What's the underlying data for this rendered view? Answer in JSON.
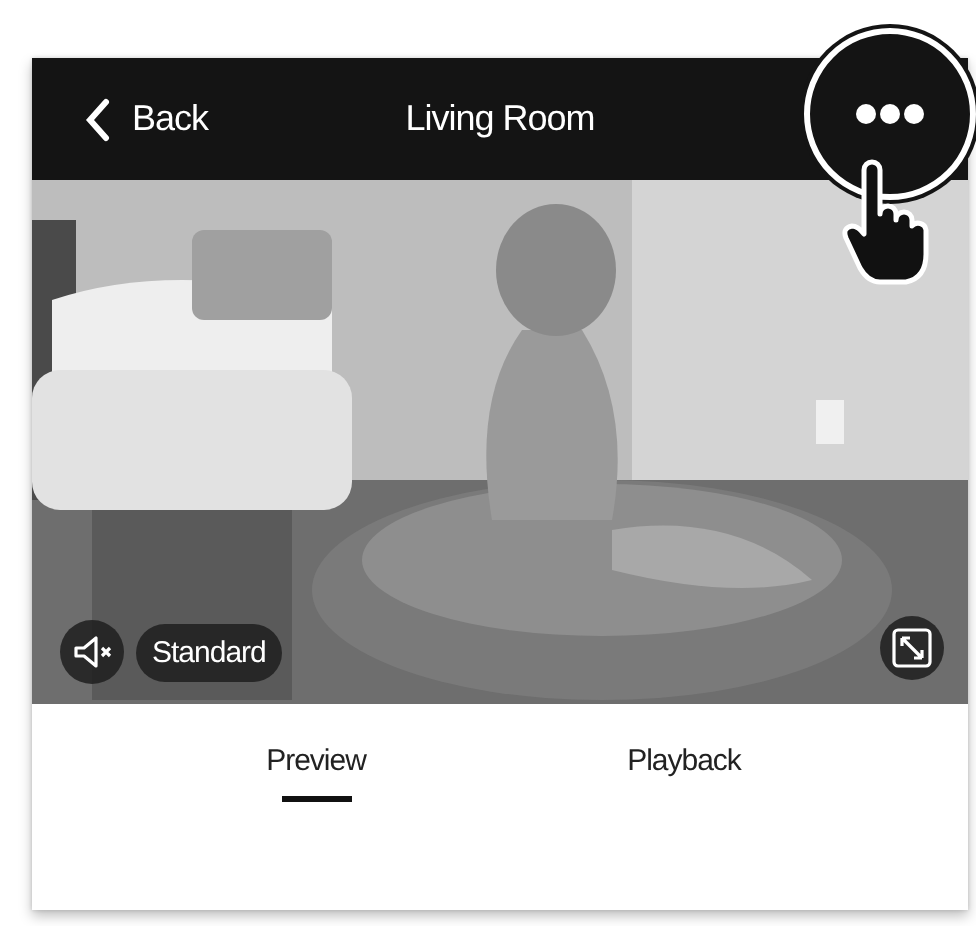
{
  "header": {
    "back_label": "Back",
    "title": "Living Room"
  },
  "video": {
    "muted": true,
    "quality": "Standard"
  },
  "tabs": [
    {
      "label": "Preview",
      "selected": true
    },
    {
      "label": "Playback",
      "selected": false
    }
  ]
}
